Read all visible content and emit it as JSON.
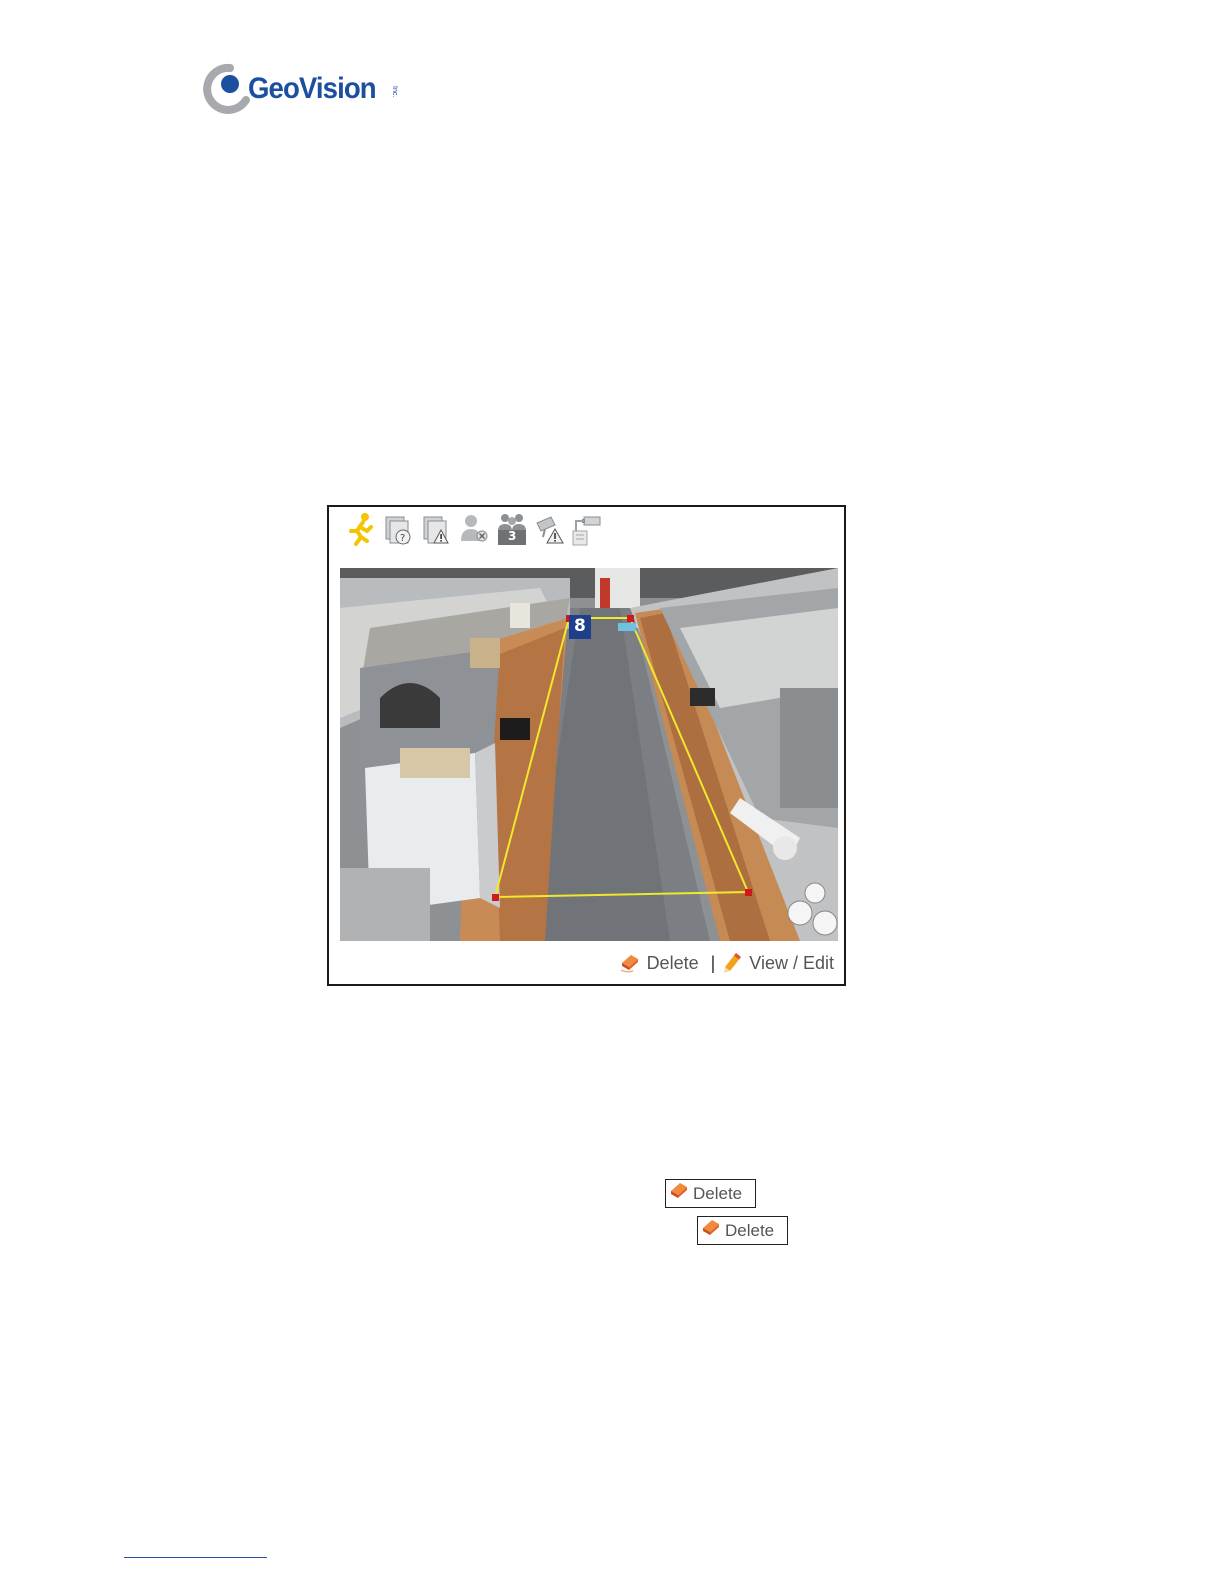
{
  "brand": {
    "name": "GeoVision",
    "suffix": "Inc.",
    "color": "#1d4fa1"
  },
  "toolbar": {
    "icons": [
      "running-person-icon",
      "unknown-object-icon",
      "alert-object-icon",
      "person-disappear-icon",
      "crowd-count-icon",
      "tampering-alert-icon",
      "camera-move-icon"
    ],
    "count_badge": "3"
  },
  "video": {
    "zone_label": "8",
    "zone_color": "#f0e82c",
    "handle_color": "#d0191c"
  },
  "actions": {
    "delete_label": "Delete",
    "separator": "|",
    "view_edit_label": "View / Edit"
  },
  "inline_buttons": [
    {
      "label": "Delete"
    },
    {
      "label": "Delete"
    }
  ]
}
